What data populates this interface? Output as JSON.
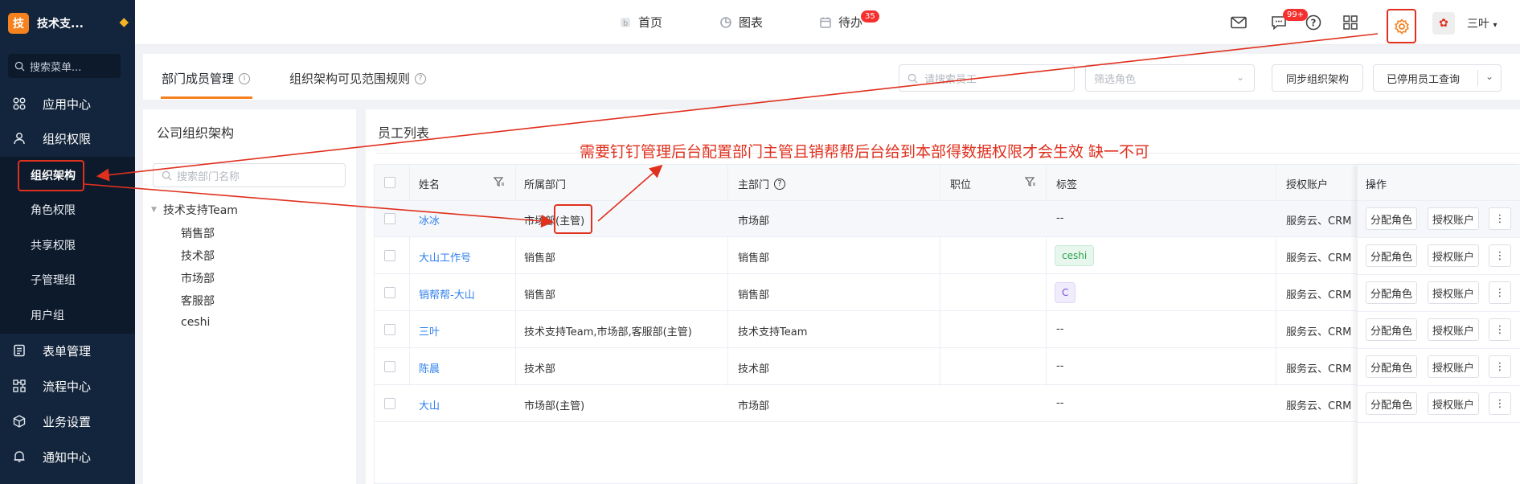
{
  "sidebar": {
    "brand_logo": "技",
    "brand_name": "技术支...",
    "search_placeholder": "搜索菜单...",
    "menu": [
      {
        "label": "应用中心",
        "icon": "apps-icon"
      },
      {
        "label": "组织权限",
        "icon": "user-icon"
      },
      {
        "label": "表单管理",
        "icon": "form-icon"
      },
      {
        "label": "流程中心",
        "icon": "flow-icon"
      },
      {
        "label": "业务设置",
        "icon": "cube-icon"
      },
      {
        "label": "通知中心",
        "icon": "bell-icon"
      }
    ],
    "submenu": [
      {
        "label": "组织架构",
        "active": true
      },
      {
        "label": "角色权限"
      },
      {
        "label": "共享权限"
      },
      {
        "label": "子管理组"
      },
      {
        "label": "用户组"
      }
    ]
  },
  "topbar": {
    "nav": [
      {
        "label": "首页",
        "icon": "home-icon"
      },
      {
        "label": "图表",
        "icon": "chart-icon"
      },
      {
        "label": "待办",
        "icon": "calendar-icon",
        "badge": "35"
      }
    ],
    "message_badge": "99+",
    "username": "三叶"
  },
  "tabs": {
    "items": [
      {
        "label": "部门成员管理",
        "active": true
      },
      {
        "label": "组织架构可见范围规则"
      }
    ],
    "search_placeholder": "请搜索员工",
    "role_filter_placeholder": "筛选角色",
    "sync_button": "同步组织架构",
    "disabled_query_button": "已停用员工查询"
  },
  "org_panel": {
    "title": "公司组织架构",
    "search_placeholder": "搜索部门名称",
    "root": "技术支持Team",
    "children": [
      "销售部",
      "技术部",
      "市场部",
      "客服部",
      "ceshi"
    ]
  },
  "employee_panel": {
    "title": "员工列表",
    "columns": [
      "姓名",
      "所属部门",
      "主部门",
      "职位",
      "标签",
      "授权账户",
      "操作"
    ],
    "rows": [
      {
        "name": "冰冰",
        "dept": "市场部(主管)",
        "main_dept": "市场部",
        "position": "",
        "tag": "--",
        "account": "服务云、CRM"
      },
      {
        "name": "大山工作号",
        "dept": "销售部",
        "main_dept": "销售部",
        "position": "",
        "tag": "ceshi",
        "account": "服务云、CRM"
      },
      {
        "name": "销帮帮-大山",
        "dept": "销售部",
        "main_dept": "销售部",
        "position": "",
        "tag": "C",
        "account": "服务云、CRM"
      },
      {
        "name": "三叶",
        "dept": "技术支持Team,市场部,客服部(主管)",
        "main_dept": "技术支持Team",
        "position": "",
        "tag": "--",
        "account": "服务云、CRM"
      },
      {
        "name": "陈晨",
        "dept": "技术部",
        "main_dept": "技术部",
        "position": "",
        "tag": "--",
        "account": "服务云、CRM"
      },
      {
        "name": "大山",
        "dept": "市场部(主管)",
        "main_dept": "市场部",
        "position": "",
        "tag": "--",
        "account": "服务云、CRM"
      }
    ],
    "actions": {
      "assign_role": "分配角色",
      "authorize": "授权账户",
      "more": "⋮"
    }
  },
  "annotation": {
    "text": "需要钉钉管理后台配置部门主管且销帮帮后台给到本部得数据权限才会生效  缺一不可",
    "color": "#e0301e"
  },
  "colors": {
    "accent": "#f5811f",
    "link": "#2f80ed",
    "sidebar_bg": "#13253c"
  }
}
